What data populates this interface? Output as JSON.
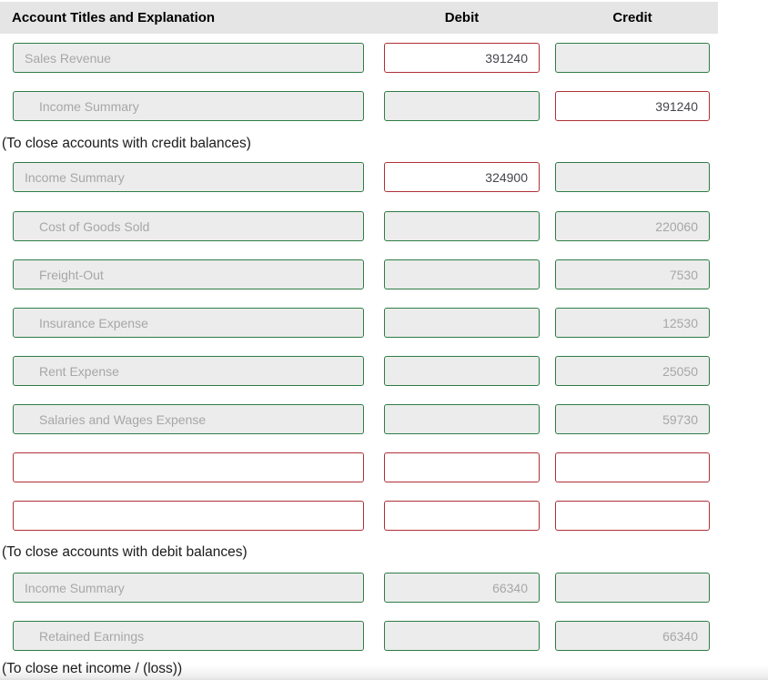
{
  "header": {
    "account": "Account Titles and Explanation",
    "debit": "Debit",
    "credit": "Credit"
  },
  "captions": {
    "credit_balances": "(To close accounts with credit balances)",
    "debit_balances": "(To close accounts with debit balances)",
    "net_income": "(To close net income / (loss))"
  },
  "rows": [
    {
      "account": "Sales Revenue",
      "indent": false,
      "debit": "391240",
      "credit": "",
      "account_state": "correct",
      "debit_state": "incorrect",
      "credit_state": "correct"
    },
    {
      "account": "Income Summary",
      "indent": true,
      "debit": "",
      "credit": "391240",
      "account_state": "correct",
      "debit_state": "correct",
      "credit_state": "incorrect"
    },
    {
      "account": "Income Summary",
      "indent": false,
      "debit": "324900",
      "credit": "",
      "account_state": "correct",
      "debit_state": "incorrect",
      "credit_state": "correct"
    },
    {
      "account": "Cost of Goods Sold",
      "indent": true,
      "debit": "",
      "credit": "220060",
      "account_state": "correct",
      "debit_state": "correct",
      "credit_state": "correct"
    },
    {
      "account": "Freight-Out",
      "indent": true,
      "debit": "",
      "credit": "7530",
      "account_state": "correct",
      "debit_state": "correct",
      "credit_state": "correct"
    },
    {
      "account": "Insurance Expense",
      "indent": true,
      "debit": "",
      "credit": "12530",
      "account_state": "correct",
      "debit_state": "correct",
      "credit_state": "correct"
    },
    {
      "account": "Rent Expense",
      "indent": true,
      "debit": "",
      "credit": "25050",
      "account_state": "correct",
      "debit_state": "correct",
      "credit_state": "correct"
    },
    {
      "account": "Salaries and Wages Expense",
      "indent": true,
      "debit": "",
      "credit": "59730",
      "account_state": "correct",
      "debit_state": "correct",
      "credit_state": "correct"
    },
    {
      "account": "",
      "indent": false,
      "debit": "",
      "credit": "",
      "account_state": "incorrect",
      "debit_state": "incorrect",
      "credit_state": "incorrect"
    },
    {
      "account": "",
      "indent": false,
      "debit": "",
      "credit": "",
      "account_state": "incorrect",
      "debit_state": "incorrect",
      "credit_state": "incorrect"
    },
    {
      "account": "Income Summary",
      "indent": false,
      "debit": "66340",
      "credit": "",
      "account_state": "correct",
      "debit_state": "correct",
      "credit_state": "correct"
    },
    {
      "account": "Retained Earnings",
      "indent": true,
      "debit": "",
      "credit": "66340",
      "account_state": "correct",
      "debit_state": "correct",
      "credit_state": "correct"
    }
  ],
  "colors": {
    "correct_border": "#2e7d46",
    "incorrect_border": "#b03036",
    "disabled_bg": "#ececec",
    "muted_text": "#a7a7a7",
    "entered_text": "#45454c",
    "header_bg": "#e5e5e5"
  }
}
